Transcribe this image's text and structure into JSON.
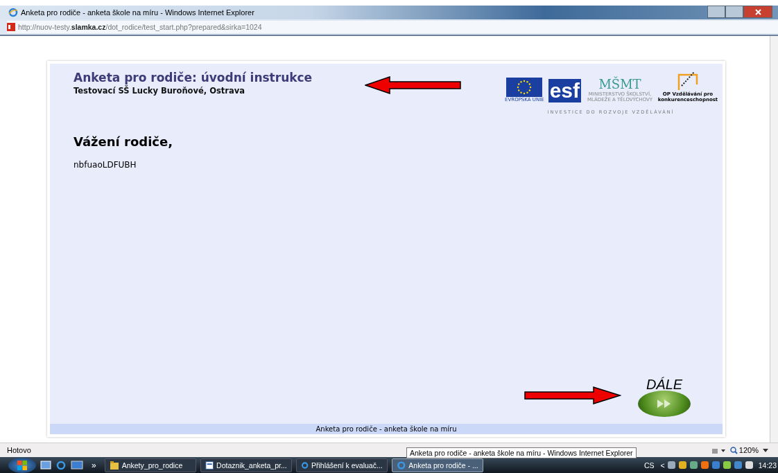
{
  "window": {
    "title": "Anketa pro rodiče - anketa škole na míru - Windows Internet Explorer"
  },
  "address": {
    "prefix": "http://nuov-testy.",
    "domain": "slamka.cz",
    "path": "/dot_rodice/test_start.php?prepared&sirka=1024"
  },
  "page": {
    "heading": "Anketa pro rodiče: úvodní instrukce",
    "school": "Testovací SŠ Lucky Buroňové, Ostrava",
    "logos": {
      "eu_label": "EVROPSKÁ UNIE",
      "esf": "esf",
      "msmt": "MŠMT",
      "msmt_sub": "MINISTERSTVO ŠKOLSTVÍ, MLÁDEŽE A TĚLOVÝCHOVY",
      "op_label": "OP Vzdělávání pro konkurenceschopnost",
      "slogan": "INVESTICE DO ROZVOJE VZDĚLÁVÁNÍ"
    },
    "greeting": "Vážení rodiče,",
    "body": "nbfuaoLDFUBH",
    "next_button": "DÁLE",
    "footer": "Anketa pro rodiče - anketa škole na míru"
  },
  "status_bar": {
    "text": "Hotovo",
    "zoom": "120%"
  },
  "tooltip": "Anketa pro rodiče - anketa škole na míru - Windows Internet Explorer",
  "taskbar": {
    "overflow": "»",
    "tasks": [
      {
        "label": "Ankety_pro_rodice",
        "kind": "folder",
        "selected": false
      },
      {
        "label": "Dotaznik_anketa_pr...",
        "kind": "document",
        "selected": false
      },
      {
        "label": "Přihlášení k evaluač...",
        "kind": "browser",
        "selected": false
      },
      {
        "label": "Anketa pro rodiče - ...",
        "kind": "browser",
        "selected": true
      }
    ],
    "language": "CS",
    "tray_expand": "<",
    "clock": "14:23"
  }
}
